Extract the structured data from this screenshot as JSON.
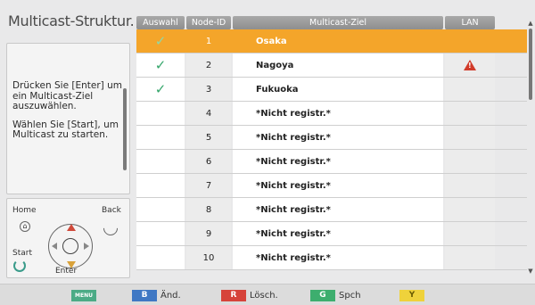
{
  "left_panel": {
    "title": "Multicast-Struktur.",
    "help_line1": "Drücken Sie [Enter] um ein Multicast-Ziel auszuwählen.",
    "help_line2": "Wählen Sie [Start], um Multicast zu starten.",
    "remote": {
      "home_label": "Home",
      "back_label": "Back",
      "start_label": "Start",
      "enter_label": "Enter"
    }
  },
  "table": {
    "headers": {
      "selection": "Auswahl",
      "node_id": "Node-ID",
      "target": "Multicast-Ziel",
      "lan": "LAN"
    },
    "rows": [
      {
        "selected": true,
        "checked": true,
        "node_id": "1",
        "target": "Osaka",
        "lan_warning": false
      },
      {
        "selected": false,
        "checked": true,
        "node_id": "2",
        "target": "Nagoya",
        "lan_warning": true
      },
      {
        "selected": false,
        "checked": true,
        "node_id": "3",
        "target": "Fukuoka",
        "lan_warning": false
      },
      {
        "selected": false,
        "checked": false,
        "node_id": "4",
        "target": "*Nicht registr.*",
        "lan_warning": false
      },
      {
        "selected": false,
        "checked": false,
        "node_id": "5",
        "target": "*Nicht registr.*",
        "lan_warning": false
      },
      {
        "selected": false,
        "checked": false,
        "node_id": "6",
        "target": "*Nicht registr.*",
        "lan_warning": false
      },
      {
        "selected": false,
        "checked": false,
        "node_id": "7",
        "target": "*Nicht registr.*",
        "lan_warning": false
      },
      {
        "selected": false,
        "checked": false,
        "node_id": "8",
        "target": "*Nicht registr.*",
        "lan_warning": false
      },
      {
        "selected": false,
        "checked": false,
        "node_id": "9",
        "target": "*Nicht registr.*",
        "lan_warning": false
      },
      {
        "selected": false,
        "checked": false,
        "node_id": "10",
        "target": "*Nicht registr.*",
        "lan_warning": false
      }
    ]
  },
  "footer": {
    "menu_key": "MENU",
    "b_key": "B",
    "b_label": "Änd.",
    "r_key": "R",
    "r_label": "Lösch.",
    "g_key": "G",
    "g_label": "Spch",
    "y_key": "Y"
  },
  "colors": {
    "selected_row": "#f4a52a",
    "check": "#35a66b",
    "warning": "#d13b2a",
    "menu_key": "#4cab86",
    "b_key": "#3f78c4",
    "r_key": "#d6433a",
    "g_key": "#3dae6e",
    "y_key": "#efd23b"
  }
}
